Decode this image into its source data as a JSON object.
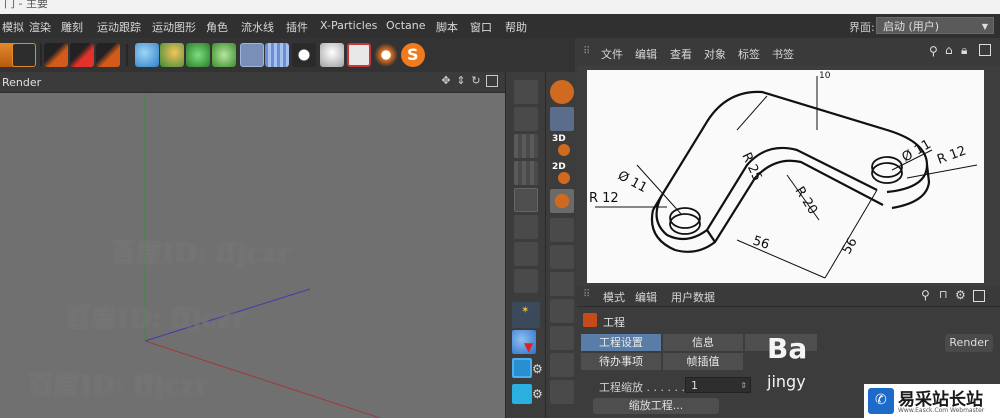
{
  "window": {
    "title": "门 - 主要"
  },
  "menubar": {
    "items": [
      "模拟",
      "渲染",
      "雕刻",
      "运动跟踪",
      "运动图形",
      "角色",
      "流水线",
      "插件",
      "X-Particles",
      "Octane",
      "脚本",
      "窗口",
      "帮助"
    ],
    "layout_label": "界面:",
    "layout_value": "启动 (用户)"
  },
  "toolbar": {
    "buttons": [
      "undo-icon",
      "make-editable-icon",
      "render-view-icon",
      "render-picture-viewer-icon",
      "render-settings-icon",
      "cube-icon",
      "pen-icon",
      "subdivision-icon",
      "array-icon",
      "deformer-icon",
      "floor-icon",
      "camera-icon",
      "light-icon",
      "tag-icon",
      "effector-icon",
      "sketch-icon"
    ]
  },
  "viewport": {
    "title": "Render",
    "controls": [
      "move-view-icon",
      "zoom-view-icon",
      "rotate-view-icon",
      "maximize-view-icon"
    ],
    "watermarks": [
      "百度ID: ffjczr",
      "百度ID: ffjczr",
      "百度ID: ffjczr"
    ]
  },
  "mode_palette": {
    "texts": [
      "3D",
      "2D"
    ]
  },
  "object_manager": {
    "menu": [
      "文件",
      "编辑",
      "查看",
      "对象",
      "标签",
      "书签"
    ]
  },
  "drawing": {
    "labels": [
      "10",
      "R 25",
      "Ø 11",
      "R 12",
      "R 20",
      "56",
      "Ø 11",
      "R 12",
      "56"
    ]
  },
  "attributes": {
    "menu": [
      "模式",
      "编辑",
      "用户数据"
    ],
    "section_title": "工程",
    "tabs": [
      "工程设置",
      "信息",
      "待办事项",
      "帧插值"
    ],
    "scale_label": "工程缩放",
    "scale_value": "1",
    "scale_button": "缩放工程...",
    "render_button": "Render",
    "baidu_logo": "Ba",
    "jingyan": "jingy"
  },
  "corner_logo": {
    "title": "易采站长站",
    "subtitle": "Www.Easck.Com Webmaster"
  },
  "colors": {
    "accent_orange": "#f07a1c",
    "tab_active": "#5a7da8",
    "viewport_bg": "#707070"
  }
}
